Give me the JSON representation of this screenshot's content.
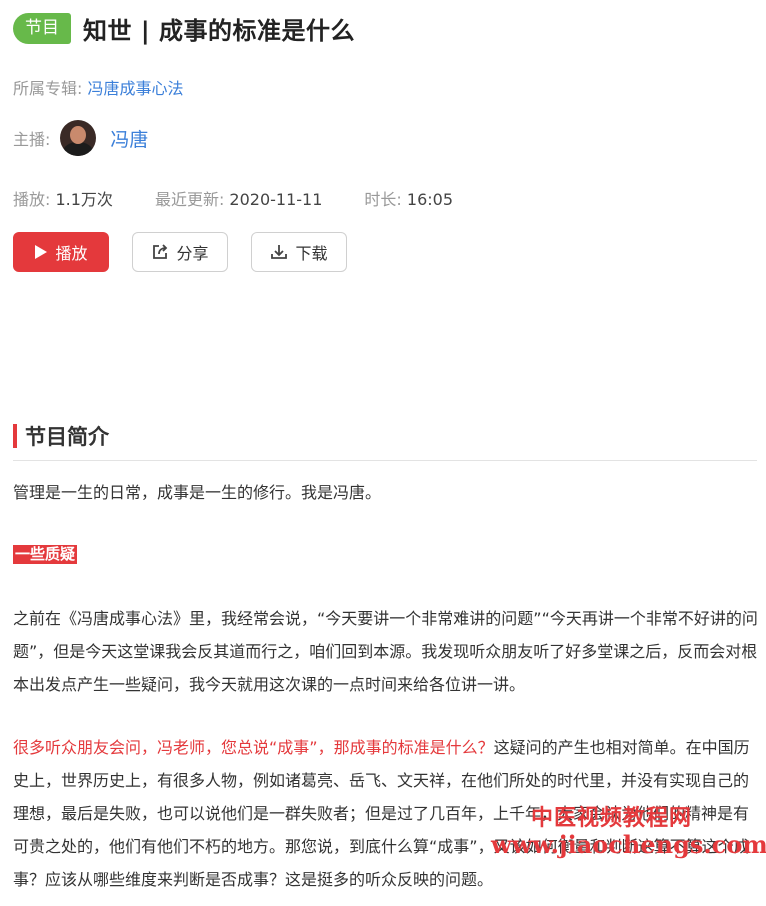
{
  "header": {
    "tag": "节目",
    "title": "知世 | 成事的标准是什么"
  },
  "album": {
    "label": "所属专辑: ",
    "name": "冯唐成事心法"
  },
  "host": {
    "label": "主播:",
    "name": "冯唐"
  },
  "meta": {
    "plays_label": "播放: ",
    "plays": "1.1万次",
    "updated_label": "最近更新: ",
    "updated": "2020-11-11",
    "duration_label": "时长: ",
    "duration": "16:05"
  },
  "actions": {
    "play": "播放",
    "share": "分享",
    "download": "下载"
  },
  "section": {
    "title": "节目简介"
  },
  "content": {
    "intro": "管理是一生的日常，成事是一生的修行。我是冯唐。",
    "heading": "一些质疑",
    "p1": "之前在《冯唐成事心法》里，我经常会说，“今天要讲一个非常难讲的问题”“今天再讲一个非常不好讲的问题”，但是今天这堂课我会反其道而行之，咱们回到本源。我发现听众朋友听了好多堂课之后，反而会对根本出发点产生一些疑问，我今天就用这次课的一点时间来给各位讲一讲。",
    "p2_red": "很多听众朋友会问，冯老师，您总说“成事”，那成事的标准是什么？",
    "p2_rest": "这疑问的产生也相对简单。在中国历史上，世界历史上，有很多人物，例如诸葛亮、岳飞、文天祥，在他们所处的时代里，并没有实现自己的理想，最后是失败，也可以说他们是一群失败者；但是过了几百年，上千年，大家会认为他们的精神是有可贵之处的，他们有他们不朽的地方。那您说，到底什么算“成事”，又该如何衡量和判断这算不算这个成事？应该从哪些维度来判断是否成事？这是挺多的听众反映的问题。"
  },
  "watermark": {
    "line1": "中医视频教程网",
    "line2": "www.jiaochengs.com"
  },
  "colors": {
    "accent_red": "#e4393c",
    "tag_green": "#67b94a",
    "link_blue": "#3b7fd9"
  }
}
